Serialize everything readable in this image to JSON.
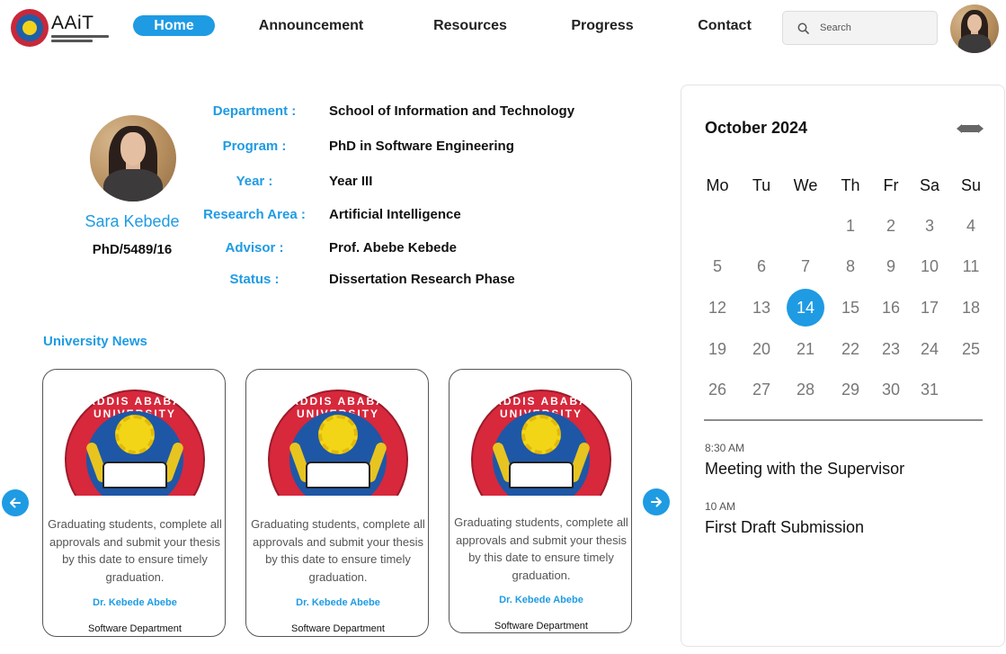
{
  "header": {
    "brand": "AAiT",
    "nav": [
      "Home",
      "Announcement",
      "Resources",
      "Progress",
      "Contact"
    ],
    "active_nav": "Home",
    "search_placeholder": "Search",
    "accent_color": "#1e9be3"
  },
  "profile": {
    "name": "Sara Kebede",
    "student_id": "PhD/5489/16",
    "fields": [
      {
        "label": "Department :",
        "value": "School of Information and Technology"
      },
      {
        "label": "Program :",
        "value": "PhD in Software Engineering"
      },
      {
        "label": "Year :",
        "value": "Year III"
      },
      {
        "label": "Research Area :",
        "value": "Artificial Intelligence"
      },
      {
        "label": "Advisor :",
        "value": "Prof. Abebe Kebede"
      },
      {
        "label": "Status :",
        "value": "Dissertation Research Phase"
      }
    ]
  },
  "news": {
    "title": "University News",
    "cards": [
      {
        "text": "Graduating students, complete all approvals and submit your thesis by this date to ensure timely graduation.",
        "author": "Dr. Kebede Abebe",
        "department": "Software Department",
        "emblem_text": "ADDIS ABABA UNIVERSITY"
      },
      {
        "text": "Graduating students, complete all approvals and submit your thesis by this date to ensure timely graduation.",
        "author": "Dr. Kebede Abebe",
        "department": "Software Department",
        "emblem_text": "ADDIS ABABA UNIVERSITY"
      },
      {
        "text": "Graduating students, complete all approvals and submit your thesis by this date to ensure timely graduation.",
        "author": "Dr. Kebede Abebe",
        "department": "Software Department",
        "emblem_text": "ADDIS ABABA UNIVERSITY"
      }
    ],
    "icons": {
      "prev": "arrow-left-icon",
      "next": "arrow-right-icon"
    }
  },
  "calendar": {
    "month_title": "October 2024",
    "weekdays": [
      "Mo",
      "Tu",
      "We",
      "Th",
      "Fr",
      "Sa",
      "Su"
    ],
    "first_weekday_index": 3,
    "days_in_month": 31,
    "today": 14,
    "events": [
      {
        "time": "8:30 AM",
        "title": "Meeting with the Supervisor"
      },
      {
        "time": "10 AM",
        "title": "First Draft Submission"
      }
    ]
  }
}
